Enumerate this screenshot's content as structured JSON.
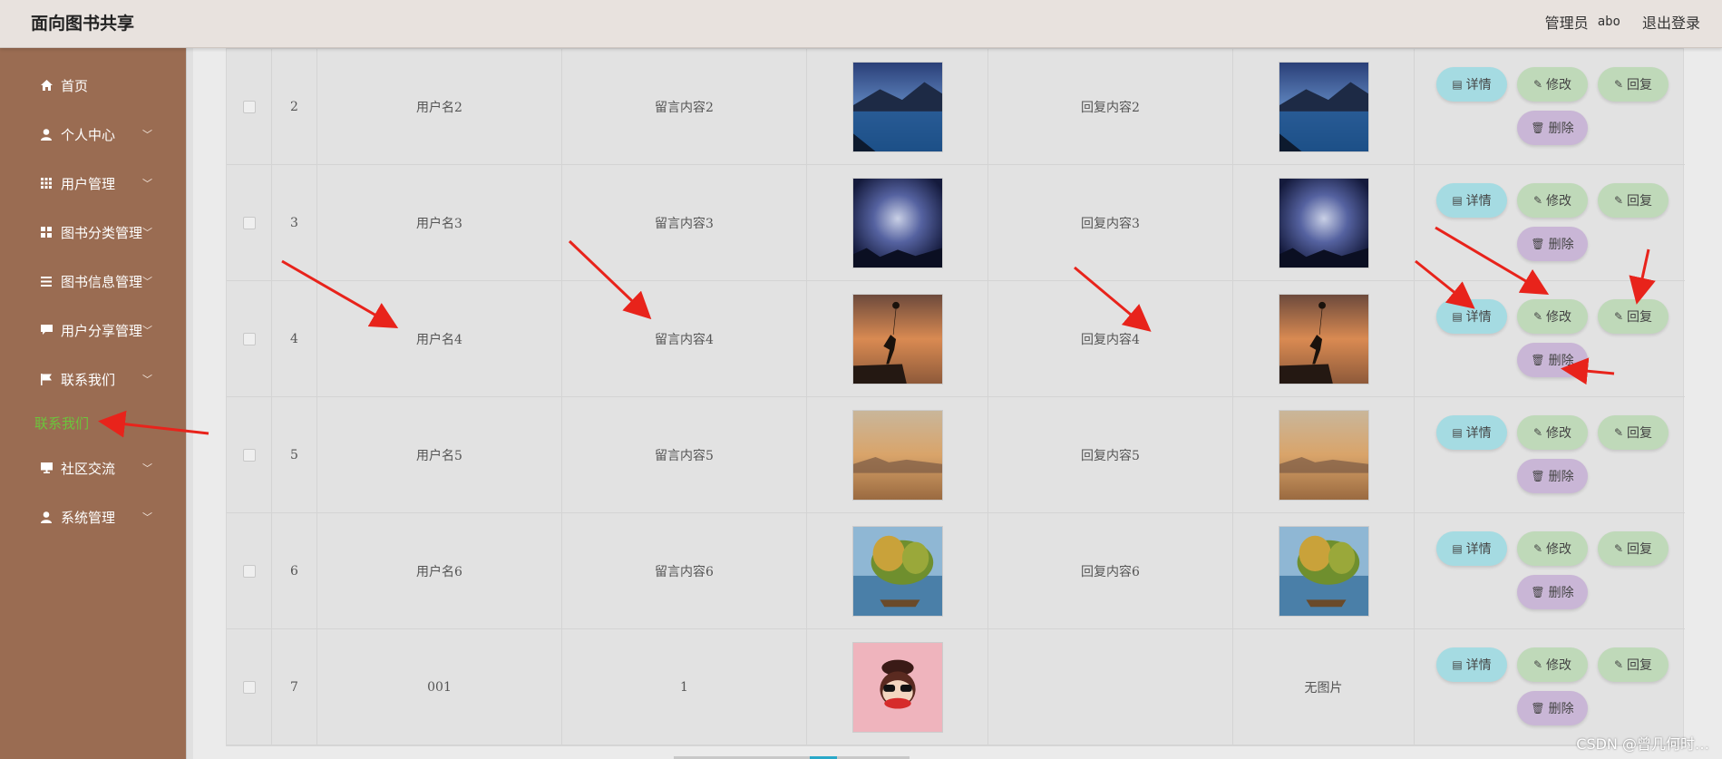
{
  "header": {
    "title": "面向图书共享",
    "admin_role": "管理员",
    "admin_name": "abo",
    "logout": "退出登录"
  },
  "sidebar": {
    "items": [
      {
        "label": "首页",
        "icon": "home-icon"
      },
      {
        "label": "个人中心",
        "icon": "user-icon"
      },
      {
        "label": "用户管理",
        "icon": "grid-icon"
      },
      {
        "label": "图书分类管理",
        "icon": "apps-icon"
      },
      {
        "label": "图书信息管理",
        "icon": "list-icon"
      },
      {
        "label": "用户分享管理",
        "icon": "comment-icon"
      },
      {
        "label": "联系我们",
        "icon": "flag-icon"
      },
      {
        "label": "社区交流",
        "icon": "monitor-icon"
      },
      {
        "label": "系统管理",
        "icon": "user-icon"
      }
    ],
    "active_submenu": "联系我们",
    "active_color": "#6cc43c"
  },
  "table": {
    "rows": [
      {
        "index": "2",
        "username": "用户名2",
        "message": "留言内容2",
        "reply": "回复内容2",
        "reply_image_text": ""
      },
      {
        "index": "3",
        "username": "用户名3",
        "message": "留言内容3",
        "reply": "回复内容3",
        "reply_image_text": ""
      },
      {
        "index": "4",
        "username": "用户名4",
        "message": "留言内容4",
        "reply": "回复内容4",
        "reply_image_text": ""
      },
      {
        "index": "5",
        "username": "用户名5",
        "message": "留言内容5",
        "reply": "回复内容5",
        "reply_image_text": ""
      },
      {
        "index": "6",
        "username": "用户名6",
        "message": "留言内容6",
        "reply": "回复内容6",
        "reply_image_text": ""
      },
      {
        "index": "7",
        "username": "001",
        "message": "1",
        "reply": "",
        "reply_image_text": "无图片"
      }
    ],
    "buttons": {
      "detail": "详情",
      "edit": "修改",
      "reply": "回复",
      "delete": "删除"
    }
  },
  "watermark": "CSDN @曾几何时…"
}
